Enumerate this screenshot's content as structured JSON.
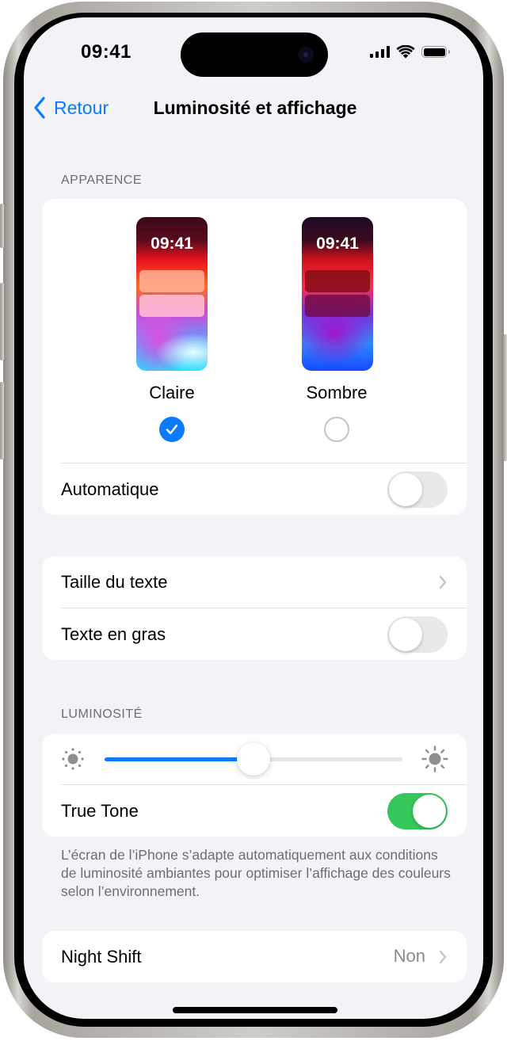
{
  "status_bar": {
    "time": "09:41",
    "icons": [
      "cellular-signal-icon",
      "wifi-icon",
      "battery-icon"
    ]
  },
  "nav": {
    "back_label": "Retour",
    "title": "Luminosité et affichage"
  },
  "appearance": {
    "header": "APPARENCE",
    "options": [
      {
        "label": "Claire",
        "preview_time": "09:41",
        "selected": true
      },
      {
        "label": "Sombre",
        "preview_time": "09:41",
        "selected": false
      }
    ],
    "automatic": {
      "label": "Automatique",
      "on": false
    }
  },
  "text_settings": {
    "text_size": {
      "label": "Taille du texte"
    },
    "bold_text": {
      "label": "Texte en gras",
      "on": false
    }
  },
  "brightness": {
    "header": "LUMINOSITÉ",
    "level_percent": 50,
    "true_tone": {
      "label": "True Tone",
      "on": true
    },
    "note": "L’écran de l’iPhone s’adapte automatiquement aux conditions de luminosité ambiantes pour optimiser l’affichage des couleurs selon l’environnement."
  },
  "night_shift": {
    "label": "Night Shift",
    "value": "Non"
  },
  "colors": {
    "accent": "#0a7aff",
    "toggle_on": "#34c759",
    "toggle_off": "#e9e9eb",
    "background": "#f2f2f7",
    "secondary_text": "#6d6d72"
  }
}
